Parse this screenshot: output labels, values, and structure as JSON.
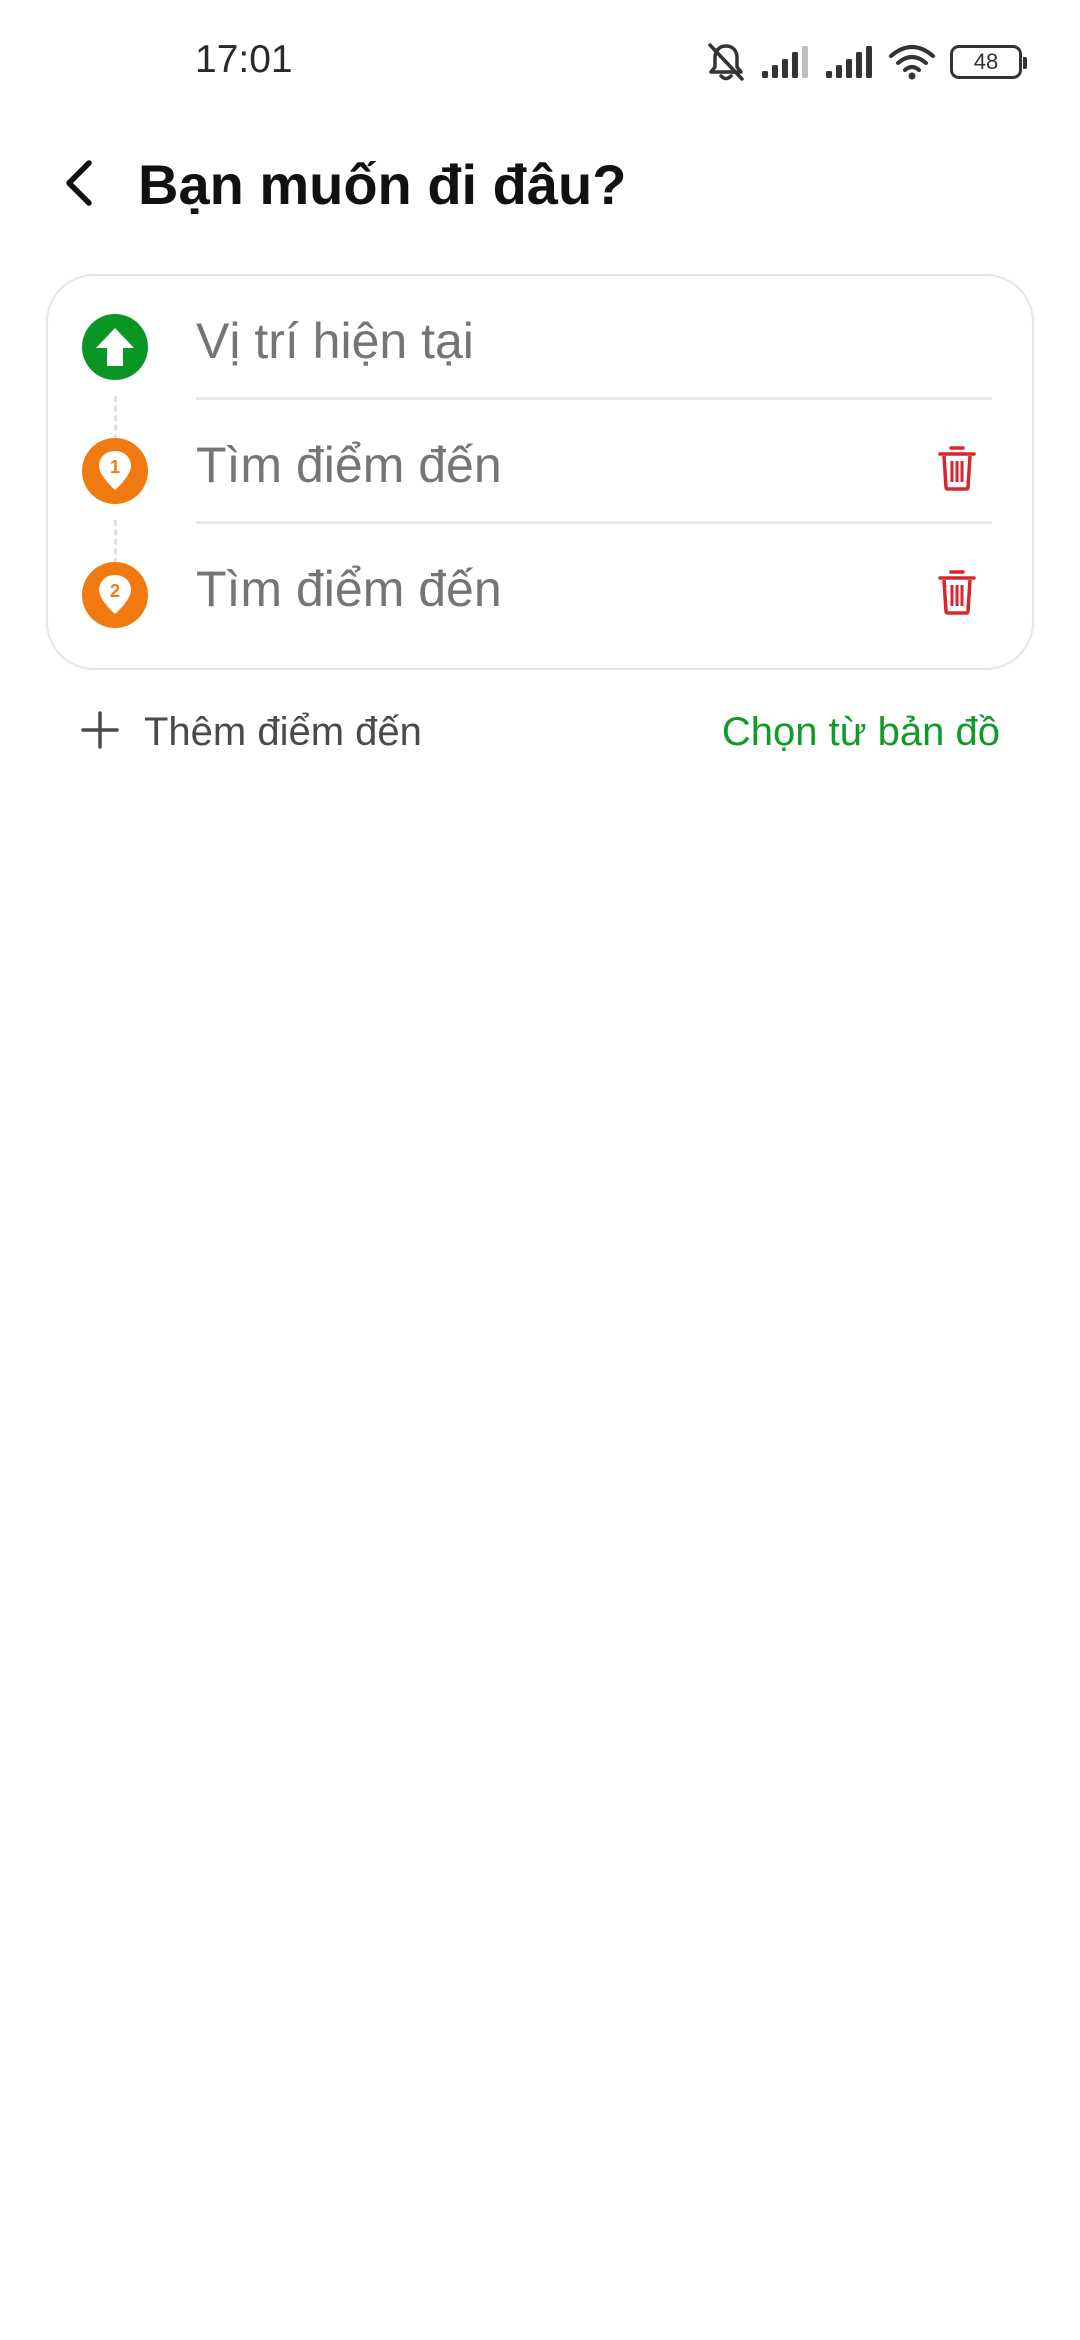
{
  "status_bar": {
    "time": "17:01",
    "battery_level": "48",
    "icons": [
      "bell-off-icon",
      "signal-icon",
      "signal-icon",
      "wifi-icon",
      "battery-icon"
    ]
  },
  "header": {
    "title": "Bạn muốn đi đâu?",
    "back_icon": "chevron-left-icon"
  },
  "route": {
    "origin": {
      "placeholder": "Vị trí hiện tại",
      "icon": "arrow-up-circle-icon",
      "icon_color": "#0a9624"
    },
    "stops": [
      {
        "marker": "1",
        "placeholder": "Tìm điểm đến",
        "icon": "map-pin-icon",
        "icon_color": "#f07a10"
      },
      {
        "marker": "2",
        "placeholder": "Tìm điểm đến",
        "icon": "map-pin-icon",
        "icon_color": "#f07a10"
      }
    ],
    "delete_icon": "trash-icon",
    "delete_color": "#d8262d"
  },
  "actions": {
    "add_destination": "Thêm điểm đến",
    "add_icon": "plus-icon",
    "choose_from_map": "Chọn từ bản đồ",
    "accent_color": "#109a2a"
  }
}
